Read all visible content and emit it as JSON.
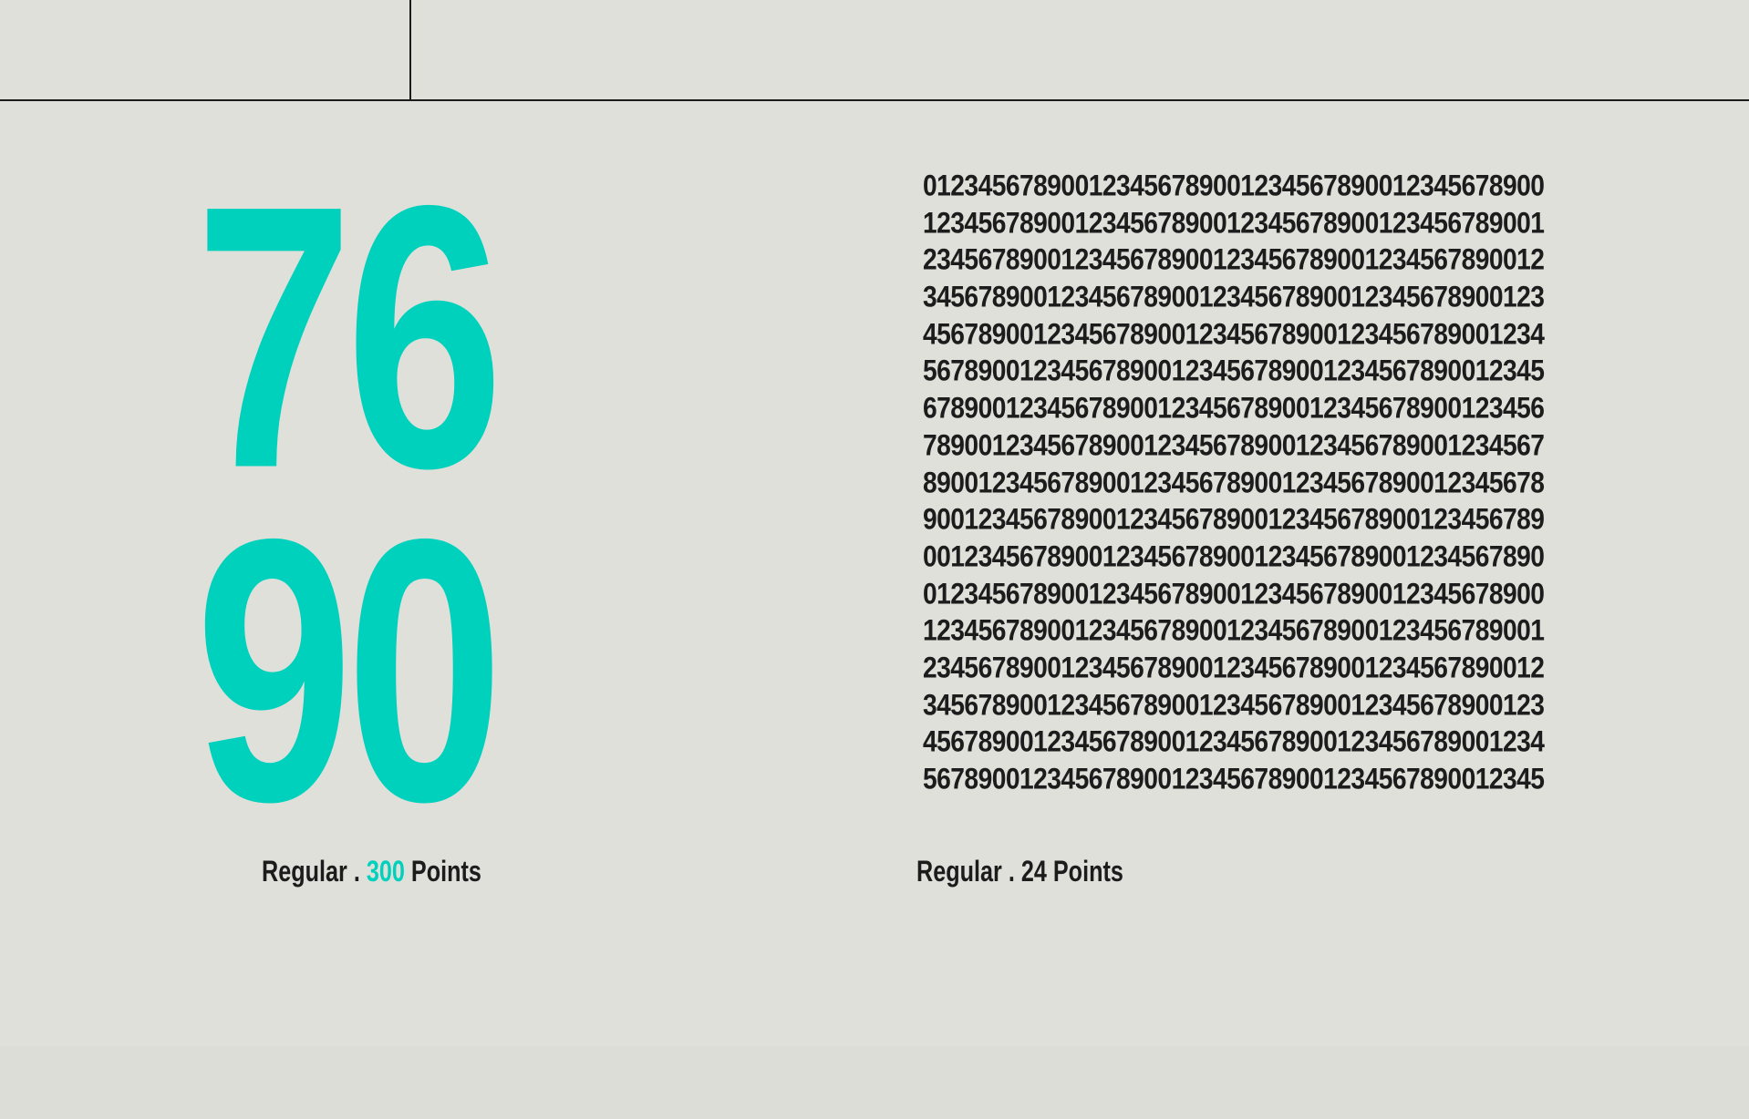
{
  "colors": {
    "accent": "#00d1bc",
    "text": "#1c1c1c",
    "background": "#dfe0da"
  },
  "display": {
    "row1": "76",
    "row2": "90"
  },
  "label_left": {
    "style": "Regular .",
    "size": "300",
    "unit": "Points"
  },
  "label_right": {
    "style": "Regular .",
    "size": "24",
    "unit": "Points"
  },
  "digit_lines": [
    "012345678900123456789001234567890012345678900",
    "123456789001234567890012345678900123456789001",
    "234567890012345678900123456789001234567890012",
    "345678900123456789001234567890012345678900123",
    "456789001234567890012345678900123456789001234",
    "567890012345678900123456789001234567890012345",
    "678900123456789001234567890012345678900123456",
    "789001234567890012345678900123456789001234567",
    "890012345678900123456789001234567890012345678",
    "900123456789001234567890012345678900123456789",
    "001234567890012345678900123456789001234567890",
    "012345678900123456789001234567890012345678900",
    "123456789001234567890012345678900123456789001",
    "234567890012345678900123456789001234567890012",
    "345678900123456789001234567890012345678900123",
    "456789001234567890012345678900123456789001234",
    "567890012345678900123456789001234567890012345"
  ]
}
